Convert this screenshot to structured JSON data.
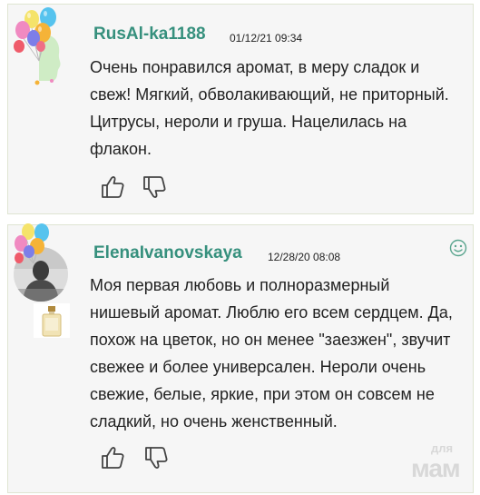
{
  "reviews": [
    {
      "username": "RusAl-ka1188",
      "datetime": "01/12/21 09:34",
      "text": "Очень понравился аромат, в меру сладок и свеж! Мягкий, обволакивающий, не приторный. Цитрусы, нероли и груша. Нацелилась на флакон.",
      "icons": [
        "balloons-icon",
        "like-icon",
        "dislike-icon"
      ]
    },
    {
      "username": "ElenaIvanovskaya",
      "datetime": "12/28/20 08:08",
      "text": "Моя первая любовь и полноразмерный нишевый аромат. Люблю его всем сердцем. Да, похож на цветок, но он менее \"заезжен\", звучит свежее и более универсален. Нероли очень свежие, белые, яркие, при этом он совсем не сладкий, но очень женственный.",
      "icons": [
        "balloons-icon",
        "avatar-photo",
        "perfume-bottle-icon",
        "smile-icon",
        "like-icon",
        "dislike-icon"
      ]
    }
  ],
  "watermark": {
    "line1": "для",
    "line2": "мам"
  },
  "colors": {
    "card_bg": "#f6f6f6",
    "card_border": "#dfe5d2",
    "username": "#36907d",
    "text": "#222222",
    "icon": "#444444"
  }
}
